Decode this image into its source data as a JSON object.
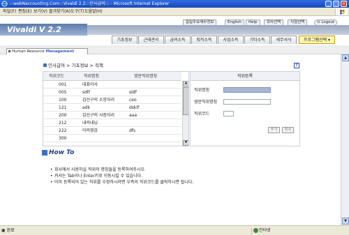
{
  "window": {
    "title": ":::webNaccounting.Com:::Vivaldi 2.2:::인사급여::: - Microsoft Internet Explorer"
  },
  "menu": [
    "파일(F)",
    "편집(E)",
    "보기(V)",
    "즐겨찾기(A)",
    "도구(T)",
    "도움말(H)"
  ],
  "header": {
    "logo": "Vivaldi  V 2.2",
    "top_links": [
      "일일주요재무정보",
      "English",
      "Help",
      "회사선택",
      "지점선택",
      "Logout"
    ],
    "nav_tabs": [
      "기초정보",
      "근태관리",
      "급여소득",
      "퇴직소득",
      "사업소득",
      "기타소득",
      "세무서식"
    ],
    "program_select": "프로그램선택"
  },
  "module": {
    "label_prefix": "Human Resource ",
    "label_emph": "Management"
  },
  "breadcrumb": "인사급여 > 기초정보 > 직책",
  "list": {
    "headers": [
      "직위코드",
      "직위명칭",
      "영문직위명칭"
    ],
    "rows": [
      [
        "001",
        "대표이사",
        ""
      ],
      [
        "005",
        "sdlf",
        "sldf"
      ],
      [
        "100",
        "김선구의 소망자리",
        "ceo"
      ],
      [
        "121",
        "adk",
        "dsklf"
      ],
      [
        "200",
        "김선구의 사장자리",
        "aaa"
      ],
      [
        "212",
        "내의내님",
        ""
      ],
      [
        "222",
        "아의영감",
        "dfs"
      ],
      [
        "300",
        "",
        ""
      ]
    ]
  },
  "register": {
    "title": "직위등록",
    "labels": [
      "직위명칭",
      "영문직위명칭",
      "직위코드"
    ],
    "add_button": "추가",
    "cancel_button": "취소"
  },
  "howto": {
    "title": "How To",
    "tips": [
      "회사에서 사용하실 직위의 명칭들을 등록하여주시오.",
      "커서는 Tab이나 Enter키로 이동시킬 수 있습니다.",
      "이미 등록되어 있는 직위를 수정하시려면 우측의 직위코드를 클릭하시면 됩니다."
    ]
  },
  "status": {
    "left": "완료",
    "zone": "인터넷"
  }
}
